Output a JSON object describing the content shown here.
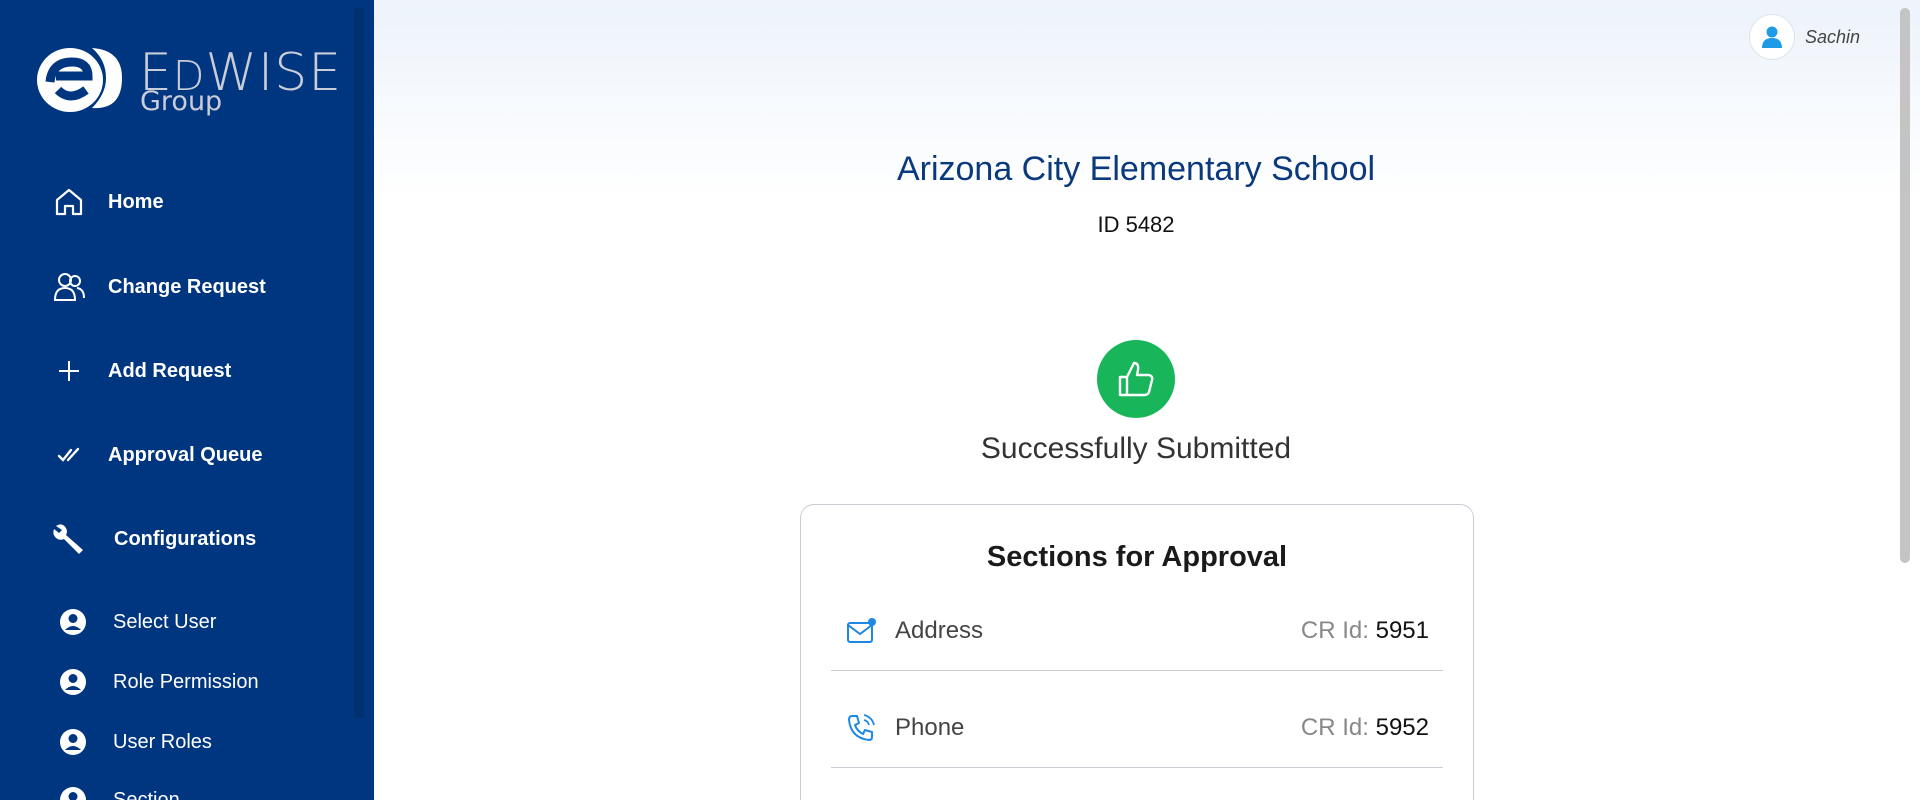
{
  "brand": {
    "word_first": "E",
    "word_d": "D",
    "word_rest": "WISE",
    "group": "Group"
  },
  "sidebar": {
    "items": [
      {
        "label": "Home"
      },
      {
        "label": "Change Request"
      },
      {
        "label": "Add Request"
      },
      {
        "label": "Approval Queue"
      },
      {
        "label": "Configurations"
      }
    ],
    "sub_items": [
      {
        "label": "Select User"
      },
      {
        "label": "Role Permission"
      },
      {
        "label": "User Roles"
      },
      {
        "label": "Section"
      }
    ]
  },
  "header": {
    "user_name": "Sachin"
  },
  "main": {
    "school_name": "Arizona City Elementary School",
    "school_id": "ID 5482",
    "status_text": "Successfully Submitted",
    "card": {
      "title": "Sections for Approval",
      "cr_label": "CR Id:",
      "rows": [
        {
          "label": "Address",
          "cr_id": "5951",
          "icon": "mail-icon"
        },
        {
          "label": "Phone",
          "cr_id": "5952",
          "icon": "phone-icon"
        }
      ]
    }
  },
  "colors": {
    "sidebar_bg": "#003580",
    "title_blue": "#0a3a7d",
    "success_green": "#19b55b",
    "icon_blue": "#1e88e5"
  }
}
